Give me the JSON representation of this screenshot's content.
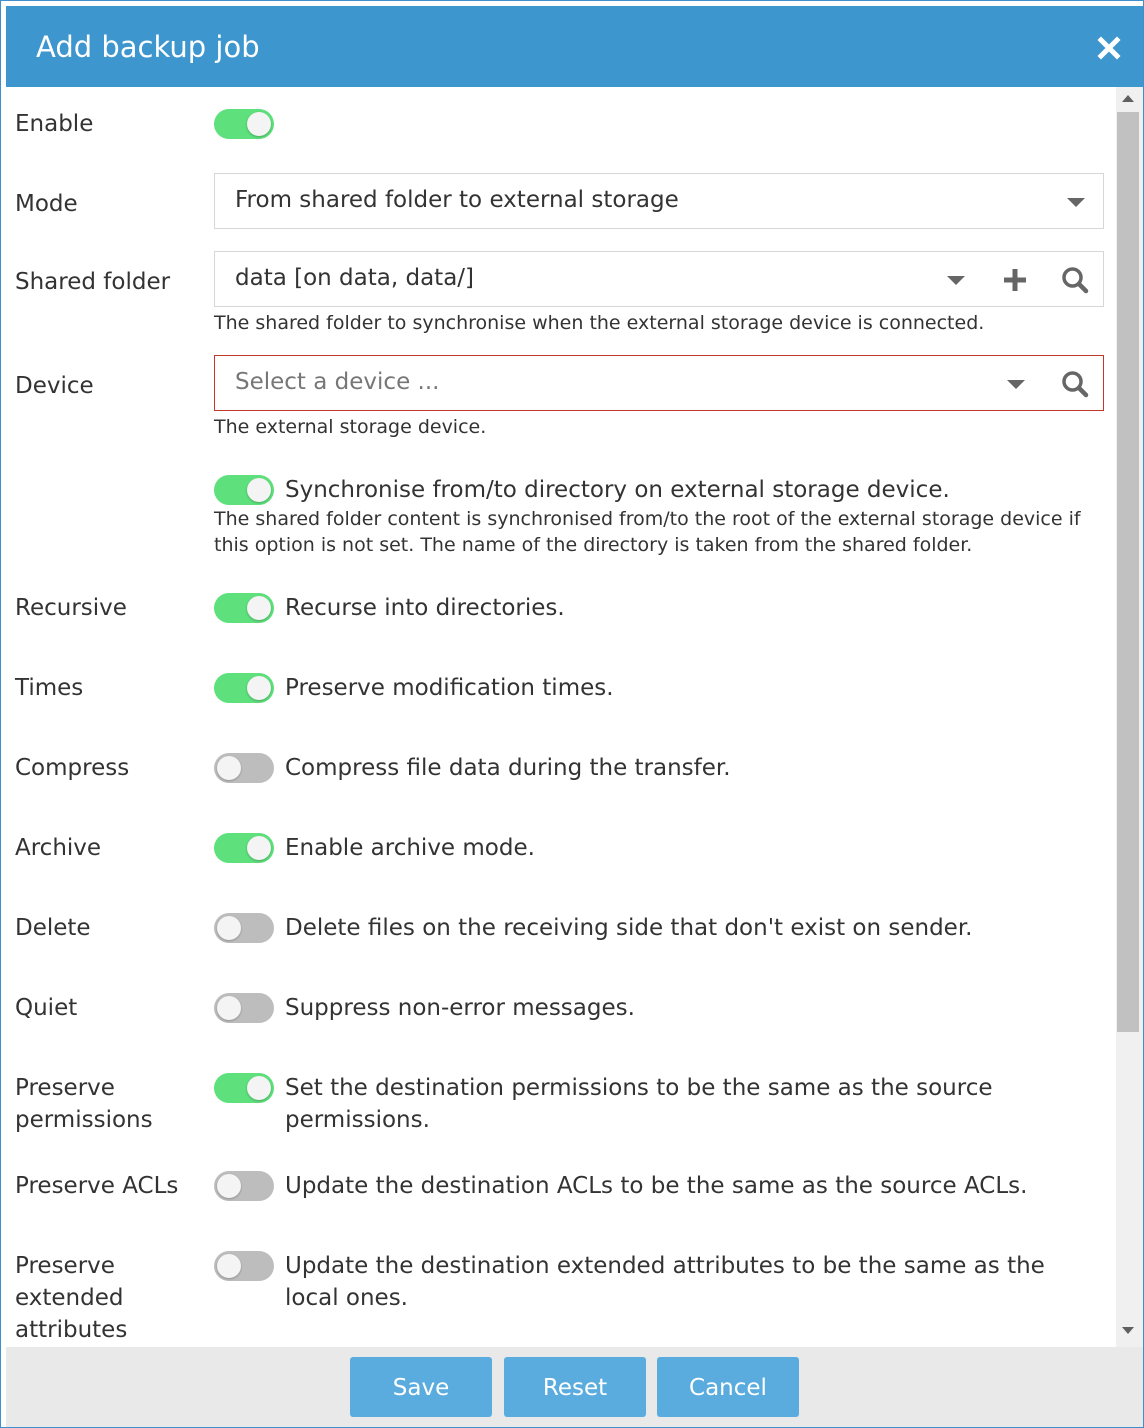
{
  "dialog": {
    "title": "Add backup job",
    "close_icon": "close-icon"
  },
  "form": {
    "enable": {
      "label": "Enable",
      "on": true
    },
    "mode": {
      "label": "Mode",
      "value": "From shared folder to external storage"
    },
    "shared_folder": {
      "label": "Shared folder",
      "value": "data [on data, data/]",
      "hint": "The shared folder to synchronise when the external storage device is connected."
    },
    "device": {
      "label": "Device",
      "placeholder": "Select a device ...",
      "hint": "The external storage device."
    },
    "usesubdir": {
      "on": true,
      "description": "Synchronise from/to directory on external storage device.",
      "hint": "The shared folder content is synchronised from/to the root of the external storage device if this option is not set. The name of the directory is taken from the shared folder."
    },
    "recursive": {
      "label": "Recursive",
      "on": true,
      "description": "Recurse into directories."
    },
    "times": {
      "label": "Times",
      "on": true,
      "description": "Preserve modification times."
    },
    "compress": {
      "label": "Compress",
      "on": false,
      "description": "Compress file data during the transfer."
    },
    "archive": {
      "label": "Archive",
      "on": true,
      "description": "Enable archive mode."
    },
    "delete": {
      "label": "Delete",
      "on": false,
      "description": "Delete files on the receiving side that don't exist on sender."
    },
    "quiet": {
      "label": "Quiet",
      "on": false,
      "description": "Suppress non-error messages."
    },
    "perms": {
      "label": "Preserve permissions",
      "on": true,
      "description": "Set the destination permissions to be the same as the source permissions."
    },
    "acls": {
      "label": "Preserve ACLs",
      "on": false,
      "description": "Update the destination ACLs to be the same as the source ACLs."
    },
    "xattrs": {
      "label": "Preserve extended attributes",
      "on": false,
      "description": "Update the destination extended attributes to be the same as the local ones."
    }
  },
  "footer": {
    "save": "Save",
    "reset": "Reset",
    "cancel": "Cancel"
  },
  "colors": {
    "title_bar": "#3e96ce",
    "toggle_on": "#5ee07c",
    "toggle_off": "#bdbdbd",
    "button": "#5aacde",
    "error_border": "#c0392b"
  }
}
